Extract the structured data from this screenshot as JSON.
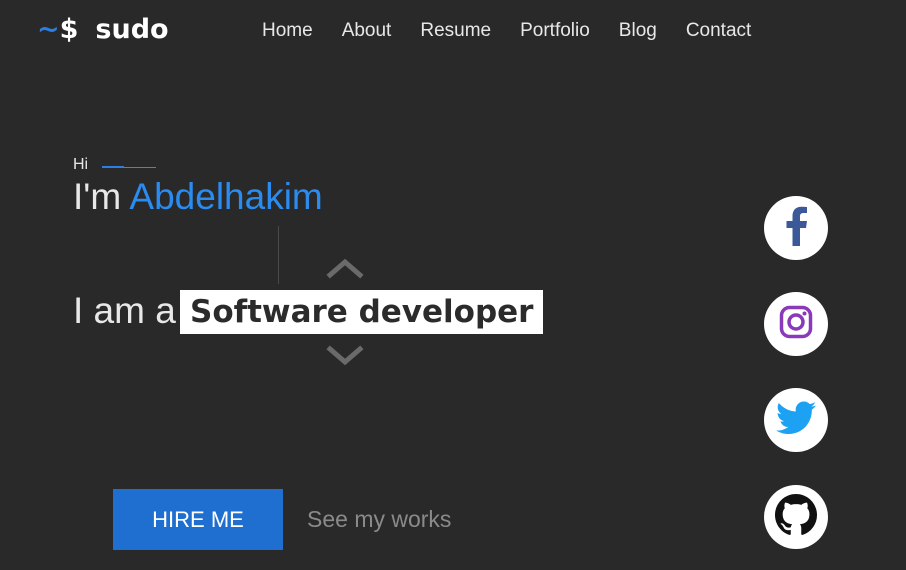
{
  "header": {
    "logo_tilde": "~",
    "logo_dollar": "$",
    "logo_name": "sudo",
    "nav": [
      {
        "label": "Home"
      },
      {
        "label": "About"
      },
      {
        "label": "Resume"
      },
      {
        "label": "Portfolio"
      },
      {
        "label": "Blog"
      },
      {
        "label": "Contact"
      }
    ]
  },
  "hero": {
    "greeting": "Hi",
    "intro_prefix": "I'm",
    "name": "Abdelhakim",
    "role_prefix": "I am a",
    "role": "Software developer",
    "hire_label": "HIRE ME",
    "works_label": "See my works"
  },
  "social": [
    {
      "icon": "facebook-icon",
      "color": "#3b5998"
    },
    {
      "icon": "instagram-icon",
      "color": "#8a3ab9"
    },
    {
      "icon": "twitter-icon",
      "color": "#1da1f2"
    },
    {
      "icon": "github-icon",
      "color": "#111111"
    }
  ],
  "colors": {
    "background": "#292929",
    "accent": "#2a8cf0",
    "button": "#1f6fd0"
  }
}
